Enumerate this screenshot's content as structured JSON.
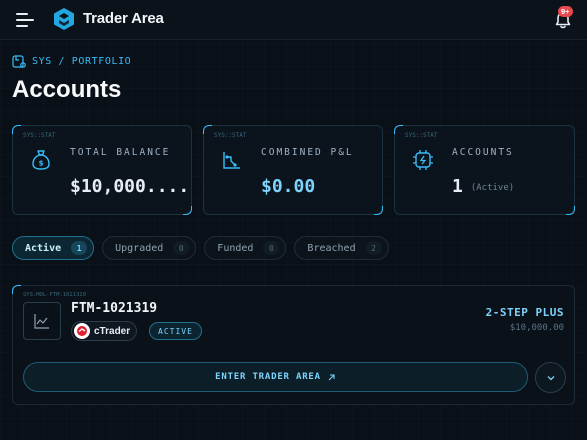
{
  "header": {
    "brand": "Trader Area",
    "notifications_badge": "9+"
  },
  "breadcrumb": "SYS / PORTFOLIO",
  "page_title": "Accounts",
  "stats": [
    {
      "tag": "SYS::STAT",
      "label": "TOTAL BALANCE",
      "value": "$10,000....",
      "icon": "money-bag-icon"
    },
    {
      "tag": "SYS::STAT",
      "label": "COMBINED P&L",
      "value": "$0.00",
      "icon": "chart-icon"
    },
    {
      "tag": "SYS::STAT",
      "label": "ACCOUNTS",
      "value": "1",
      "sub": "(Active)",
      "icon": "chip-icon"
    }
  ],
  "tabs": [
    {
      "label": "Active",
      "count": "1",
      "active": true
    },
    {
      "label": "Upgraded",
      "count": "0"
    },
    {
      "label": "Funded",
      "count": "0"
    },
    {
      "label": "Breached",
      "count": "2"
    }
  ],
  "account": {
    "tag": "SYS:MOL-FTM-1021319",
    "id": "FTM-1021319",
    "platform": "cTrader",
    "status": "ACTIVE",
    "plan": "2-STEP PLUS",
    "size": "$10,000.00",
    "enter_label": "ENTER TRADER AREA"
  },
  "colors": {
    "accent": "#38bdf8",
    "background": "#0a1017",
    "badge": "#e5484d"
  }
}
